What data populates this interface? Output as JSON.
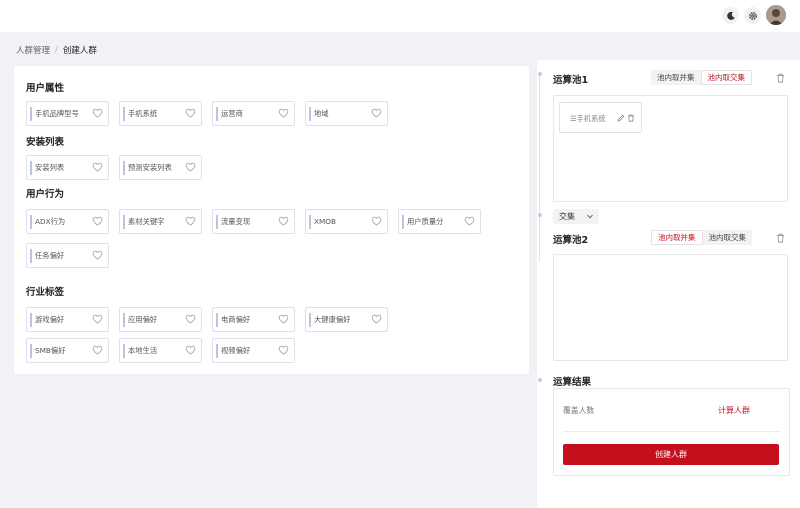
{
  "topbar": {
    "icons": [
      "moon-icon",
      "gear-icon"
    ]
  },
  "breadcrumb": {
    "parent": "人群管理",
    "separator": "/",
    "current": "创建人群"
  },
  "attributes": {
    "sections": [
      {
        "title": "用户属性",
        "chips": [
          "手机品牌型号",
          "手机系统",
          "运营商",
          "地域"
        ]
      },
      {
        "title": "安装列表",
        "chips": [
          "安装列表",
          "预测安装列表"
        ]
      },
      {
        "title": "用户行为",
        "chips": [
          "ADX行为",
          "素材关键字",
          "流量变现",
          "XMOB",
          "用户质量分",
          "任务偏好"
        ]
      },
      {
        "title": "行业标签",
        "chips": [
          "游戏偏好",
          "应用偏好",
          "电商偏好",
          "大健康偏好",
          "SMB偏好",
          "本地生活",
          "视频偏好"
        ]
      }
    ]
  },
  "pool1": {
    "title": "运算池1",
    "union_label": "池内取并集",
    "intersect_label": "池内取交集",
    "active": "intersect",
    "chip_label": "☰手机系统"
  },
  "operator": {
    "value": "交集"
  },
  "pool2": {
    "title": "运算池2",
    "union_label": "池内取并集",
    "intersect_label": "池内取交集",
    "active": "union"
  },
  "result": {
    "title": "运算结果",
    "cover_label": "覆盖人数",
    "calc_link": "计算人群",
    "create_button": "创建人群"
  },
  "colors": {
    "accent": "#c4101d",
    "chip_marker": "#b8c3e6"
  }
}
